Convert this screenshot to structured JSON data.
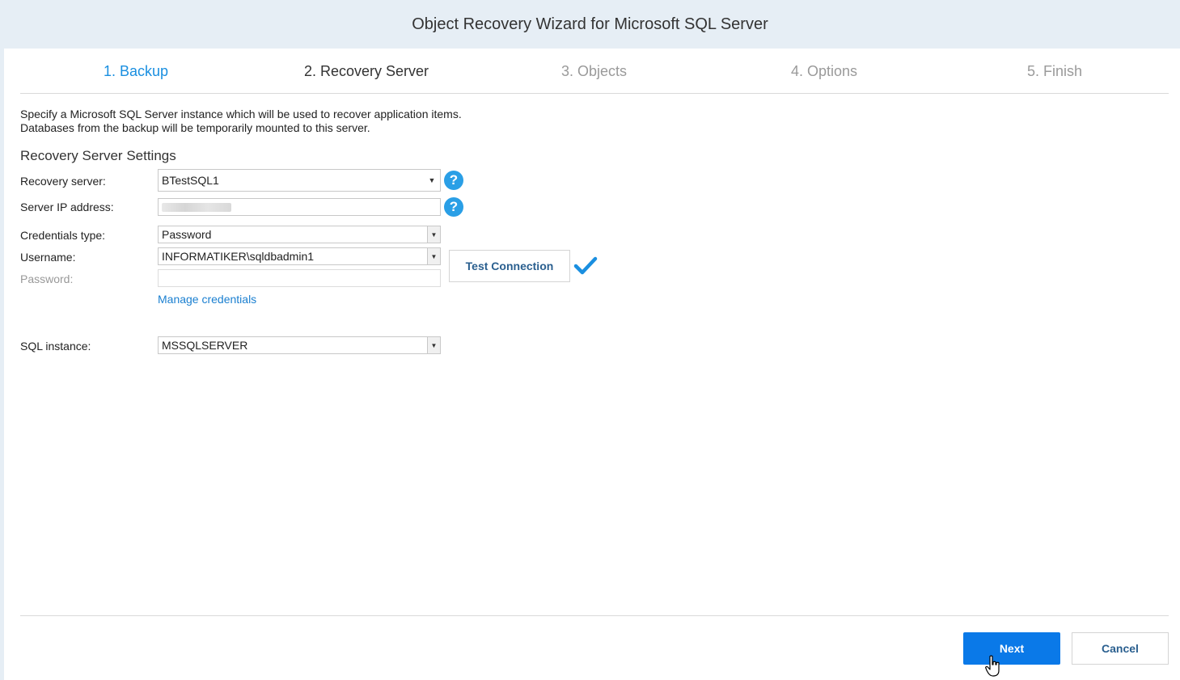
{
  "window": {
    "title": "Object Recovery Wizard for Microsoft SQL Server"
  },
  "steps": [
    {
      "label": "1. Backup",
      "state": "done"
    },
    {
      "label": "2. Recovery Server",
      "state": "current"
    },
    {
      "label": "3. Objects",
      "state": "pending"
    },
    {
      "label": "4. Options",
      "state": "pending"
    },
    {
      "label": "5. Finish",
      "state": "pending"
    }
  ],
  "description": {
    "line1": "Specify a Microsoft SQL Server instance which will be used to recover application items.",
    "line2": "Databases from the backup will be temporarily mounted to this server."
  },
  "settings": {
    "title": "Recovery Server Settings",
    "recovery_server": {
      "label": "Recovery server:",
      "value": "BTestSQL1"
    },
    "server_ip": {
      "label": "Server IP address:",
      "value": ""
    },
    "credentials_type": {
      "label": "Credentials type:",
      "value": "Password"
    },
    "username": {
      "label": "Username:",
      "value": "INFORMATIKER\\sqldbadmin1"
    },
    "password": {
      "label": "Password:",
      "value": ""
    },
    "manage_credentials": "Manage credentials",
    "test_connection": "Test Connection",
    "sql_instance": {
      "label": "SQL instance:",
      "value": "MSSQLSERVER"
    }
  },
  "icons": {
    "help": "help-icon",
    "check": "check-icon",
    "arrow": "chevron-down-icon"
  },
  "colors": {
    "accent": "#0a79e8",
    "link": "#1a8fe0",
    "help": "#2a9fe6"
  },
  "footer": {
    "next": "Next",
    "cancel": "Cancel"
  }
}
